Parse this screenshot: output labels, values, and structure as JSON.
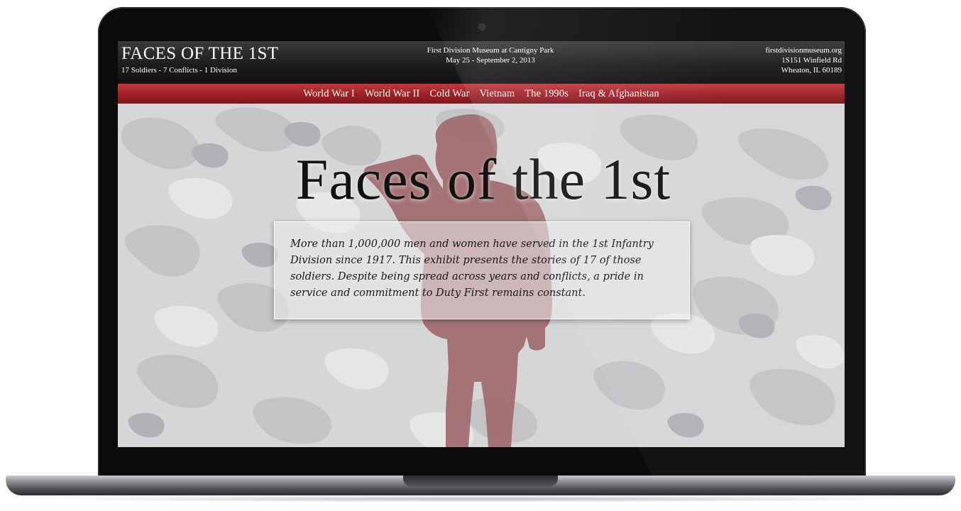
{
  "site": {
    "title": "FACES OF THE 1ST",
    "tagline": "17 Soldiers - 7 Conflicts - 1 Division"
  },
  "event": {
    "venue": "First Division Museum at Cantigny Park",
    "dates": "May 25 - September 2, 2013"
  },
  "contact": {
    "website": "firstdivisionmuseum.org",
    "street": "1S151 Winfield Rd",
    "city": "Wheaton, IL 60189"
  },
  "nav": {
    "items": [
      {
        "label": "World War I"
      },
      {
        "label": "World War II"
      },
      {
        "label": "Cold War"
      },
      {
        "label": "Vietnam"
      },
      {
        "label": "The 1990s"
      },
      {
        "label": "Iraq & Afghanistan"
      }
    ]
  },
  "hero": {
    "title": "Faces of the 1st",
    "intro": "More than 1,000,000 men and women have served in the 1st Infantry Division since 1917. This exhibit presents the stories of 17 of those soldiers. Despite being spread across years and conflicts, a pride in service and commitment to Duty First remains constant."
  },
  "colors": {
    "nav_red": "#9d1f27",
    "soldier_silhouette": "#a06a6e",
    "camo_light": "#d6d6d8",
    "camo_dark": "#b9b9bc"
  }
}
